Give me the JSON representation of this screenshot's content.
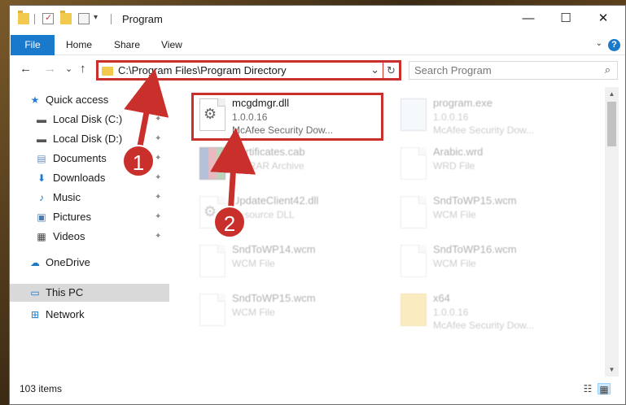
{
  "window": {
    "title": "Program",
    "minimize_glyph": "—",
    "maximize_glyph": "☐",
    "close_glyph": "✕"
  },
  "ribbon": {
    "tabs": [
      "File",
      "Home",
      "Share",
      "View"
    ],
    "help": "?"
  },
  "nav": {
    "back": "←",
    "forward": "→",
    "recent": "⌄",
    "up": "↑",
    "address": "C:\\Program Files\\Program Directory",
    "address_dropdown": "⌄",
    "refresh": "↻",
    "search_placeholder": "Search Program",
    "search_icon": "⌕"
  },
  "sidebar": {
    "items": [
      {
        "label": "Quick access",
        "icon": "star-icon",
        "glyph": "★",
        "color": "#2a7bd6",
        "pinned": false
      },
      {
        "label": "Local Disk (C:)",
        "icon": "drive-icon",
        "glyph": "▬",
        "color": "#555555",
        "pinned": true
      },
      {
        "label": "Local Disk (D:)",
        "icon": "drive-icon",
        "glyph": "▬",
        "color": "#555555",
        "pinned": true
      },
      {
        "label": "Documents",
        "icon": "documents-icon",
        "glyph": "▤",
        "color": "#6a8fbf",
        "pinned": true
      },
      {
        "label": "Downloads",
        "icon": "downloads-icon",
        "glyph": "⬇",
        "color": "#1979ca",
        "pinned": true
      },
      {
        "label": "Music",
        "icon": "music-icon",
        "glyph": "♪",
        "color": "#1979ca",
        "pinned": true
      },
      {
        "label": "Pictures",
        "icon": "pictures-icon",
        "glyph": "▣",
        "color": "#4a7ab0",
        "pinned": true
      },
      {
        "label": "Videos",
        "icon": "videos-icon",
        "glyph": "▦",
        "color": "#444444",
        "pinned": true
      },
      {
        "label": "OneDrive",
        "icon": "cloud-icon",
        "glyph": "☁",
        "color": "#1979ca",
        "pinned": false
      },
      {
        "label": "This PC",
        "icon": "pc-icon",
        "glyph": "▭",
        "color": "#1979ca",
        "pinned": false,
        "selected": true
      },
      {
        "label": "Network",
        "icon": "network-icon",
        "glyph": "⊞",
        "color": "#1979ca",
        "pinned": false
      }
    ],
    "pin_glyph": "📌"
  },
  "files": [
    {
      "name": "mcgdmgr.dll",
      "line1": "1.0.0.16",
      "line2": "McAfee Security Dow...",
      "icon": "dll-icon",
      "faded": false
    },
    {
      "name": "program.exe",
      "line1": "1.0.0.16",
      "line2": "McAfee Security Dow...",
      "icon": "exe-icon",
      "faded": true
    },
    {
      "name": "Certificates.cab",
      "line1": "WinRAR Archive",
      "line2": "",
      "icon": "archive-icon",
      "faded": true
    },
    {
      "name": "Arabic.wrd",
      "line1": "WRD File",
      "line2": "",
      "icon": "file-icon",
      "faded": true
    },
    {
      "name": "UpdateClient42.dll",
      "line1": "Resource DLL",
      "line2": "",
      "icon": "dll-icon",
      "faded": true
    },
    {
      "name": "SndToWP15.wcm",
      "line1": "WCM File",
      "line2": "",
      "icon": "file-icon",
      "faded": true
    },
    {
      "name": "SndToWP14.wcm",
      "line1": "WCM File",
      "line2": "",
      "icon": "file-icon",
      "faded": true
    },
    {
      "name": "SndToWP16.wcm",
      "line1": "WCM File",
      "line2": "",
      "icon": "file-icon",
      "faded": true
    },
    {
      "name": "SndToWP15.wcm",
      "line1": "WCM File",
      "line2": "",
      "icon": "file-icon",
      "faded": true
    },
    {
      "name": "x64",
      "line1": "1.0.0.16",
      "line2": "McAfee Security Dow...",
      "icon": "folder-icon",
      "faded": true
    }
  ],
  "annotations": {
    "marker1": "1",
    "marker2": "2",
    "accent": "#c9302c"
  },
  "scrollbar": {
    "up": "▲",
    "down": "▼"
  },
  "status": {
    "items_count": "103 items",
    "details_glyph": "☷",
    "tiles_glyph": "▦"
  }
}
